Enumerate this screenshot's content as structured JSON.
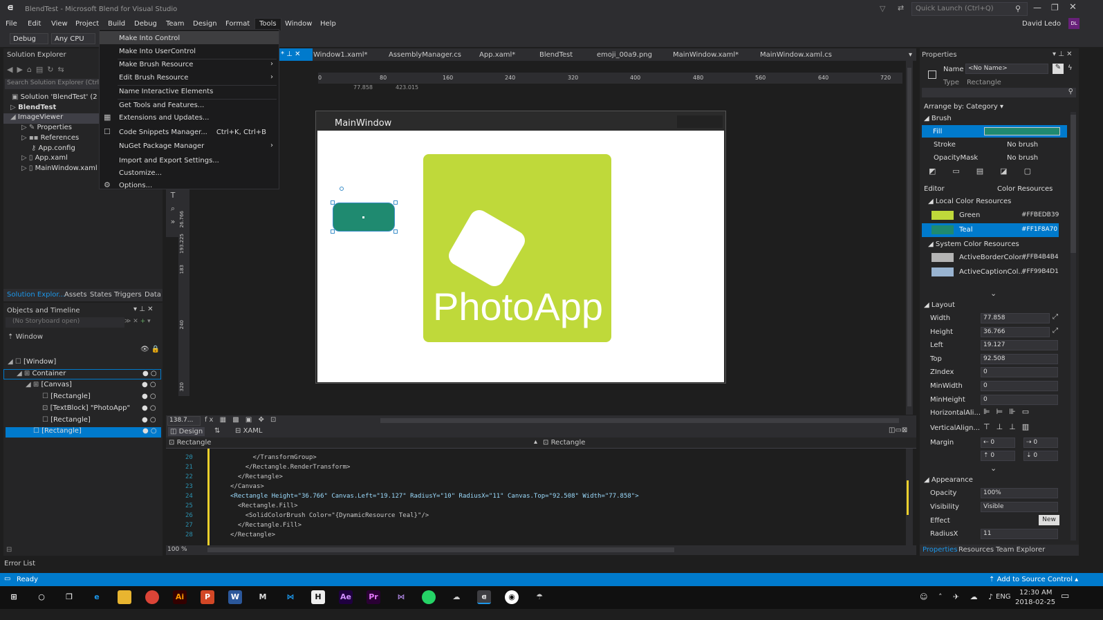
{
  "app": {
    "title": "BlendTest - Microsoft Blend for Visual Studio",
    "logo": "⋴",
    "quick_launch": "Quick Launch (Ctrl+Q)",
    "user": "David Ledo",
    "user_initials": "DL"
  },
  "menu": [
    "File",
    "Edit",
    "View",
    "Project",
    "Build",
    "Debug",
    "Team",
    "Design",
    "Format",
    "Tools",
    "Window",
    "Help"
  ],
  "toolbar": {
    "config": "Debug",
    "platform": "Any CPU"
  },
  "tools_menu": [
    {
      "label": "Make Into Control",
      "shortcut": "",
      "submenu": false
    },
    {
      "label": "Make Into UserControl",
      "shortcut": "",
      "submenu": false
    },
    {
      "label": "Make Brush Resource",
      "shortcut": "",
      "submenu": true
    },
    {
      "label": "Edit Brush Resource",
      "shortcut": "",
      "submenu": true
    },
    {
      "label": "Name Interactive Elements",
      "shortcut": "",
      "submenu": false
    },
    {
      "label": "Get Tools and Features...",
      "shortcut": "",
      "submenu": false
    },
    {
      "label": "Extensions and Updates...",
      "shortcut": "",
      "submenu": false
    },
    {
      "label": "Code Snippets Manager...",
      "shortcut": "Ctrl+K, Ctrl+B",
      "submenu": false
    },
    {
      "label": "NuGet Package Manager",
      "shortcut": "",
      "submenu": true
    },
    {
      "label": "Import and Export Settings...",
      "shortcut": "",
      "submenu": false
    },
    {
      "label": "Customize...",
      "shortcut": "",
      "submenu": false
    },
    {
      "label": "Options...",
      "shortcut": "",
      "submenu": false
    }
  ],
  "solution_explorer": {
    "title": "Solution Explorer",
    "search": "Search Solution Explorer (Ctrl",
    "items": [
      "Solution 'BlendTest' (2 pr",
      "BlendTest",
      "ImageViewer",
      "Properties",
      "References",
      "App.config",
      "App.xaml",
      "MainWindow.xaml"
    ]
  },
  "left_tabs": [
    "Solution Explor...",
    "Assets",
    "States",
    "Triggers",
    "Data"
  ],
  "objects": {
    "title": "Objects and Timeline",
    "storyboard": "(No Storyboard open)",
    "window_label": "Window",
    "tree": [
      "[Window]",
      "Container",
      "[Canvas]",
      "[Rectangle]",
      "[TextBlock] \"PhotoApp\"",
      "[Rectangle]",
      "[Rectangle]"
    ]
  },
  "doc_tabs": [
    "Window1.xaml*",
    "AssemblyManager.cs",
    "App.xaml*",
    "BlendTest",
    "emoji_00a9.png",
    "MainWindow.xaml*",
    "MainWindow.xaml.cs"
  ],
  "ruler": {
    "ticks": [
      "0",
      "80",
      "160",
      "240",
      "320",
      "400",
      "480",
      "560",
      "640",
      "720"
    ],
    "pos_a": "77.858",
    "pos_b": "423.015",
    "v_ticks": [
      "26.766",
      "193.225",
      "183",
      "240",
      "320"
    ]
  },
  "artboard": {
    "window_title": "MainWindow",
    "app_text": "PhotoApp",
    "green": "#bfd93a",
    "teal": "#1f8a70"
  },
  "view_bar": {
    "zoom": "138.7...",
    "design": "Design",
    "xaml": "XAML",
    "crumb_left": "Rectangle",
    "crumb_right": "Rectangle",
    "zoom2": "100 %"
  },
  "code": [
    {
      "n": "20",
      "t": "              </TransformGroup>"
    },
    {
      "n": "21",
      "t": "            </Rectangle.RenderTransform>"
    },
    {
      "n": "22",
      "t": "          </Rectangle>"
    },
    {
      "n": "23",
      "t": "        </Canvas>"
    },
    {
      "n": "24",
      "t": "        <Rectangle Height=\"36.766\" Canvas.Left=\"19.127\" RadiusY=\"10\" RadiusX=\"11\" Canvas.Top=\"92.508\" Width=\"77.858\">"
    },
    {
      "n": "25",
      "t": "          <Rectangle.Fill>"
    },
    {
      "n": "26",
      "t": "            <SolidColorBrush Color=\"{DynamicResource Teal}\"/>"
    },
    {
      "n": "27",
      "t": "          </Rectangle.Fill>"
    },
    {
      "n": "28",
      "t": "        </Rectangle>"
    }
  ],
  "properties": {
    "title": "Properties",
    "name_label": "Name",
    "name_value": "<No Name>",
    "type_label": "Type",
    "type_value": "Rectangle",
    "arrange": "Arrange by: Category",
    "brush_section": "Brush",
    "fill": "Fill",
    "stroke": "Stroke",
    "stroke_val": "No brush",
    "opacity_mask": "OpacityMask",
    "opacity_mask_val": "No brush",
    "editor": "Editor",
    "color_resources": "Color Resources",
    "local_res": "Local Color Resources",
    "green_name": "Green",
    "green_hex": "#FFBEDB39",
    "teal_name": "Teal",
    "teal_hex": "#FF1F8A70",
    "system_res": "System Color Resources",
    "sys1_name": "ActiveBorderColor...",
    "sys1_hex": "#FFB4B4B4",
    "sys2_name": "ActiveCaptionCol...",
    "sys2_hex": "#FF99B4D1",
    "layout_section": "Layout",
    "width": "Width",
    "width_v": "77.858",
    "height": "Height",
    "height_v": "36.766",
    "left": "Left",
    "left_v": "19.127",
    "top": "Top",
    "top_v": "92.508",
    "zindex": "ZIndex",
    "zindex_v": "0",
    "minwidth": "MinWidth",
    "minwidth_v": "0",
    "minheight": "MinHeight",
    "minheight_v": "0",
    "halign": "HorizontalAli...",
    "valign": "VerticalAlign...",
    "margin": "Margin",
    "margin_v": "0",
    "appearance_section": "Appearance",
    "opacity": "Opacity",
    "opacity_v": "100%",
    "visibility": "Visibility",
    "visibility_v": "Visible",
    "effect": "Effect",
    "effect_btn": "New",
    "radiusx": "RadiusX",
    "radiusx_v": "11"
  },
  "right_tabs": [
    "Properties",
    "Resources",
    "Team Explorer"
  ],
  "error_list": "Error List",
  "status": {
    "ready": "Ready",
    "source": "Add to Source Control"
  },
  "taskbar": {
    "lang": "ENG",
    "time": "12:30 AM",
    "date": "2018-02-25"
  }
}
